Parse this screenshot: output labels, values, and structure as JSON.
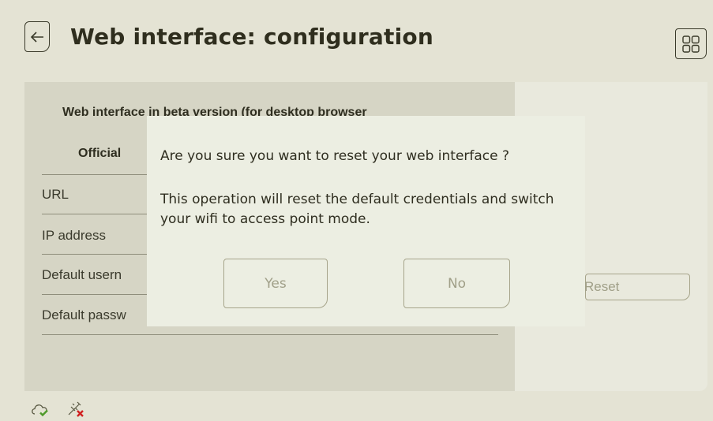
{
  "header": {
    "title": "Web interface: configuration",
    "back_icon": "arrow-left-icon",
    "menu_icon": "grid-icon"
  },
  "panel": {
    "beta_title": "Web interface in beta version (for desktop browser",
    "official_title": "Official",
    "rows": [
      {
        "label": "URL"
      },
      {
        "label": "IP address"
      },
      {
        "label": "Default usern"
      },
      {
        "label": "Default passw"
      }
    ],
    "reset_label": "Reset"
  },
  "dialog": {
    "question": "Are you sure you want to reset your web interface ?",
    "explanation": "This operation will reset the default credentials and switch your wifi to access point mode.",
    "yes_label": "Yes",
    "no_label": "No"
  },
  "status": {
    "cloud_icon": "cloud-check-icon",
    "usb_icon": "usb-disconnected-icon"
  },
  "colors": {
    "background": "#e4e3d4",
    "panel": "#d6d5c5",
    "dialog": "#eceee2",
    "text": "#2f2e20",
    "disabled_text": "#a09f88",
    "check_green": "#4f9a2b",
    "error_red": "#d02020"
  }
}
